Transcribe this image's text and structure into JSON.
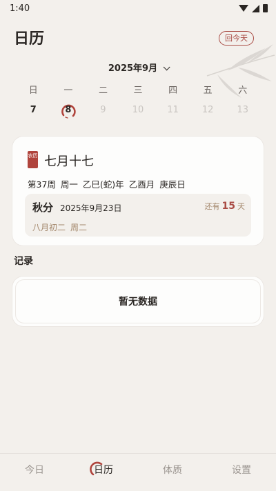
{
  "status_bar": {
    "time": "1:40",
    "icons": [
      "wifi-icon",
      "signal-icon",
      "battery-icon"
    ]
  },
  "header": {
    "title": "日历",
    "today_button": "回今天"
  },
  "calendar": {
    "month_label": "2025年9月",
    "weekdays": [
      "日",
      "一",
      "二",
      "三",
      "四",
      "五",
      "六"
    ],
    "days": [
      {
        "num": "7",
        "state": "past"
      },
      {
        "num": "8",
        "state": "today"
      },
      {
        "num": "9",
        "state": "future"
      },
      {
        "num": "10",
        "state": "future"
      },
      {
        "num": "11",
        "state": "future"
      },
      {
        "num": "12",
        "state": "future"
      },
      {
        "num": "13",
        "state": "future"
      }
    ]
  },
  "day_info": {
    "seal_text": "农历",
    "lunar_date": "七月十七",
    "week_no": "第37周",
    "weekday": "周一",
    "year_ganzhi": "乙巳(蛇)年",
    "month_ganzhi": "乙酉月",
    "day_ganzhi": "庚辰日"
  },
  "solar_term": {
    "name": "秋分",
    "date": "2025年9月23日",
    "remain_prefix": "还有",
    "remain_days": "15",
    "remain_suffix": "天",
    "lunar_date": "八月初二",
    "weekday": "周二"
  },
  "records": {
    "title": "记录",
    "empty_text": "暂无数据"
  },
  "bottom_nav": [
    {
      "label": "今日",
      "active": false
    },
    {
      "label": "日历",
      "active": true
    },
    {
      "label": "体质",
      "active": false
    },
    {
      "label": "设置",
      "active": false
    }
  ],
  "colors": {
    "accent": "#a94a43",
    "background": "#f3f0ec",
    "card": "#fdfdfc",
    "muted": "#a2866a"
  }
}
